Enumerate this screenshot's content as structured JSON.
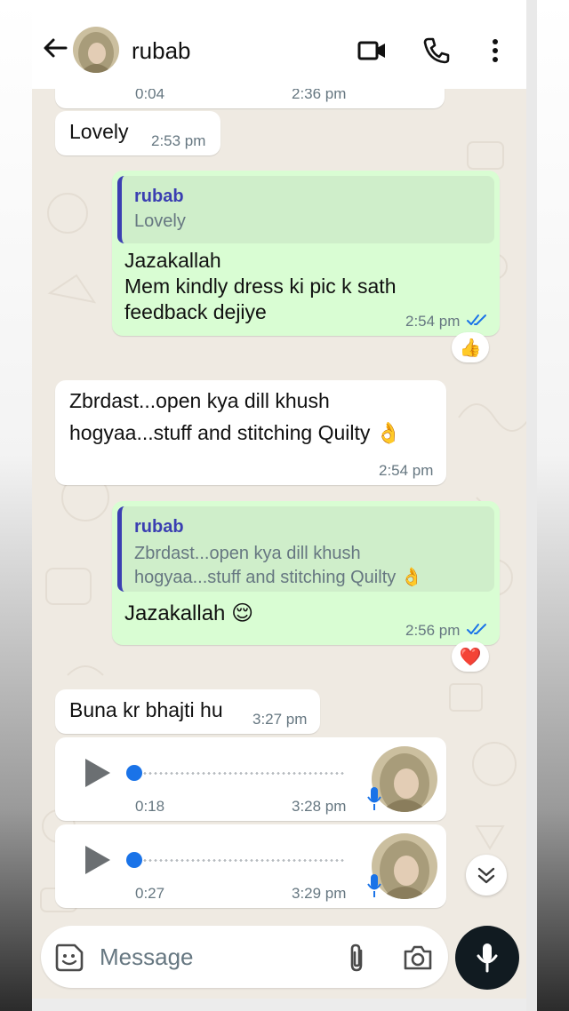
{
  "header": {
    "contact_name": "rubab",
    "icons": [
      "back-arrow-icon",
      "video-call-icon",
      "phone-call-icon",
      "more-options-icon"
    ]
  },
  "messages": [
    {
      "type": "voice",
      "direction": "in",
      "duration": "0:04",
      "time": "2:36 pm",
      "partial": true
    },
    {
      "type": "text",
      "direction": "in",
      "text": "Lovely",
      "time": "2:53 pm"
    },
    {
      "type": "reply",
      "direction": "out",
      "quote_author": "rubab",
      "quote_text": [
        "Lovely"
      ],
      "lines": [
        "Jazakallah",
        "Mem kindly dress ki pic k sath",
        "feedback dejiye"
      ],
      "time": "2:54 pm",
      "status": "read",
      "reaction": "👍"
    },
    {
      "type": "text",
      "direction": "in",
      "lines": [
        "Zbrdast...open kya dill khush",
        "hogyaa...stuff and stitching Quilty 👌"
      ],
      "time": "2:54 pm"
    },
    {
      "type": "reply",
      "direction": "out",
      "quote_author": "rubab",
      "quote_text": [
        "Zbrdast...open kya dill khush",
        "hogyaa...stuff and stitching Quilty 👌"
      ],
      "lines": [
        "Jazakallah 😌"
      ],
      "time": "2:56 pm",
      "status": "read",
      "reaction": "❤️"
    },
    {
      "type": "text",
      "direction": "in",
      "text": "Buna kr bhajti hu",
      "time": "3:27 pm"
    },
    {
      "type": "voice",
      "direction": "in",
      "duration": "0:18",
      "time": "3:28 pm",
      "progress": 0
    },
    {
      "type": "voice",
      "direction": "in",
      "duration": "0:27",
      "time": "3:29 pm",
      "progress": 0
    }
  ],
  "composer": {
    "placeholder": "Message",
    "icons": [
      "sticker-icon",
      "attach-icon",
      "camera-icon",
      "mic-icon"
    ]
  },
  "colors": {
    "chat_bg": "#efeae2",
    "incoming_bubble": "#ffffff",
    "outgoing_bubble": "#d9fdd3",
    "quote_accent": "#3b3fb2",
    "read_ticks": "#1a73e8",
    "mic_button": "#111b21"
  }
}
